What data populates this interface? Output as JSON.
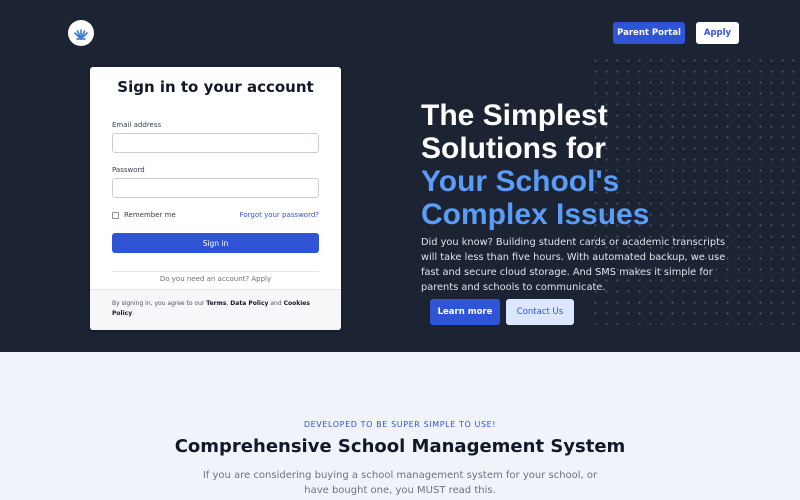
{
  "nav": {
    "parent_portal": "Parent Portal",
    "apply": "Apply"
  },
  "signin": {
    "title": "Sign in to your account",
    "email_label": "Email address",
    "email_value": "",
    "password_label": "Password",
    "password_value": "",
    "remember_label": "Remember me",
    "forgot_label": "Forgot your password?",
    "submit_label": "Sign in",
    "need_account": "Do you need an account? Apply",
    "footer_prefix": "By signing in, you agree to our",
    "terms": "Terms",
    "comma": ",",
    "data_policy": "Data Policy",
    "and": "and",
    "cookies_policy": "Cookies Policy",
    "period": "."
  },
  "hero": {
    "headline_line1": "The Simplest",
    "headline_line2": "Solutions for",
    "headline_line3": "Your School's",
    "headline_line4": "Complex Issues",
    "description": "Did you know? Building student cards or academic transcripts will take less than five hours. With automated backup, we use fast and secure cloud storage. And SMS makes it simple for parents and schools to communicate.",
    "learn_more": "Learn more",
    "contact_us": "Contact Us"
  },
  "section": {
    "eyebrow": "DEVELOPED TO BE SUPER SIMPLE TO USE!",
    "title": "Comprehensive School Management System",
    "description": "If you are considering buying a school management system for your school, or have bought one, you MUST read this."
  },
  "colors": {
    "hero_bg": "#1c2333",
    "accent": "#2f54d6",
    "headline_blue": "#5a9cf6",
    "section_bg": "#f0f4fa"
  },
  "icons": {
    "logo": "school-logo-icon"
  }
}
